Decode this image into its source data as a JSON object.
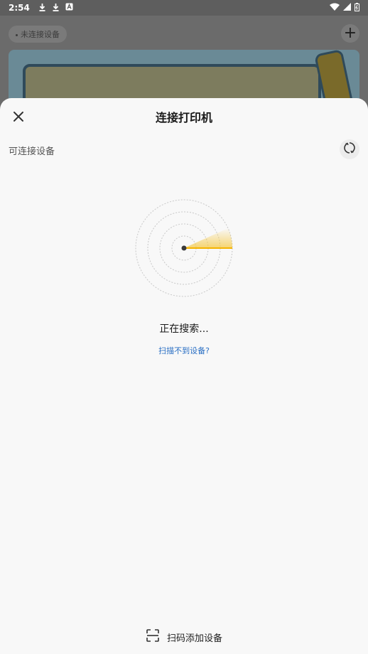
{
  "status_bar": {
    "time": "2:54",
    "left_icons": [
      "download-icon",
      "download-icon",
      "app-notification-icon"
    ],
    "right_icons": [
      "wifi-icon",
      "signal-icon",
      "battery-icon"
    ]
  },
  "background_app": {
    "device_status": "未连接设备",
    "add_icon": "plus-icon"
  },
  "sheet": {
    "title": "连接打印机",
    "close_icon": "close-icon",
    "section_label": "可连接设备",
    "refresh_icon": "refresh-icon",
    "search_status": "正在搜索...",
    "cant_find_link": "扫描不到设备?",
    "scan_add_label": "扫码添加设备",
    "scan_icon": "scan-icon"
  },
  "colors": {
    "accent_link": "#2a6fc4",
    "radar_sweep": "#f5b400",
    "sheet_bg": "#f8f8f8",
    "overlay_bg": "#6f6f6f"
  }
}
